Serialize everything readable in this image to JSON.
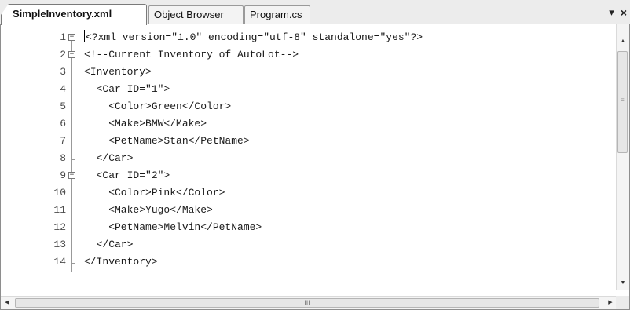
{
  "tabs": [
    {
      "label": "SimpleInventory.xml",
      "active": true
    },
    {
      "label": "Object Browser",
      "active": false
    },
    {
      "label": "Program.cs",
      "active": false
    }
  ],
  "tab_controls": {
    "dropdown_icon": "▾",
    "close_icon": "×"
  },
  "editor": {
    "lines": [
      {
        "number": "1",
        "text": "<?xml version=\"1.0\" encoding=\"utf-8\" standalone=\"yes\"?>"
      },
      {
        "number": "2",
        "text": "<!--Current Inventory of AutoLot-->"
      },
      {
        "number": "3",
        "text": "<Inventory>"
      },
      {
        "number": "4",
        "text": "  <Car ID=\"1\">"
      },
      {
        "number": "5",
        "text": "    <Color>Green</Color>"
      },
      {
        "number": "6",
        "text": "    <Make>BMW</Make>"
      },
      {
        "number": "7",
        "text": "    <PetName>Stan</PetName>"
      },
      {
        "number": "8",
        "text": "  </Car>"
      },
      {
        "number": "9",
        "text": "  <Car ID=\"2\">"
      },
      {
        "number": "10",
        "text": "    <Color>Pink</Color>"
      },
      {
        "number": "11",
        "text": "    <Make>Yugo</Make>"
      },
      {
        "number": "12",
        "text": "    <PetName>Melvin</PetName>"
      },
      {
        "number": "13",
        "text": "  </Car>"
      },
      {
        "number": "14",
        "text": "</Inventory>"
      }
    ]
  },
  "scrollbars": {
    "horizontal_grip": "III",
    "vertical_grip": "≡"
  }
}
